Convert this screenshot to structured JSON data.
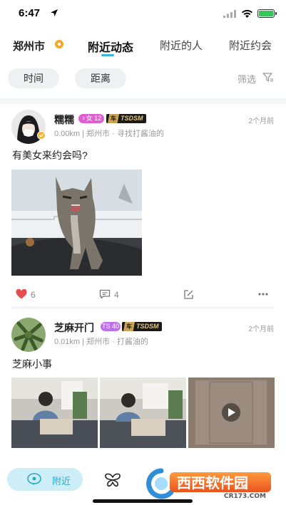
{
  "status_bar": {
    "time": "6:47"
  },
  "header": {
    "city": "郑州市",
    "tabs": [
      {
        "label": "附近动态",
        "active": true
      },
      {
        "label": "附近的人",
        "active": false
      },
      {
        "label": "附近约会",
        "active": false
      }
    ]
  },
  "filters": {
    "time": "时间",
    "distance": "距离",
    "filter": "筛选"
  },
  "posts": [
    {
      "nickname": "糯糯",
      "gender_badge": "♀女 12",
      "vip_mark": "车",
      "vip_label": "TSDSM",
      "meta": "0.00km | 郑州市 · 寻找打酱油的",
      "time_ago": "2个月前",
      "text": "有美女来约会吗?",
      "likes": "6",
      "comments": "4"
    },
    {
      "nickname": "芝麻开门",
      "gender_badge": "TS 40",
      "vip_mark": "车",
      "vip_label": "TSDSM",
      "meta": "0.01km | 郑州市 · 打酱油的",
      "time_ago": "2个月前",
      "text": "芝麻小事"
    }
  ],
  "bottom_nav": {
    "nearby": "附近"
  },
  "watermark": {
    "main": "西西软件园",
    "sub": "CR173.COM"
  },
  "colors": {
    "accent": "#3ab8d8",
    "like": "#e74c4c",
    "female_badge": "#e05fd0",
    "ts_badge": "#c06ef0"
  }
}
